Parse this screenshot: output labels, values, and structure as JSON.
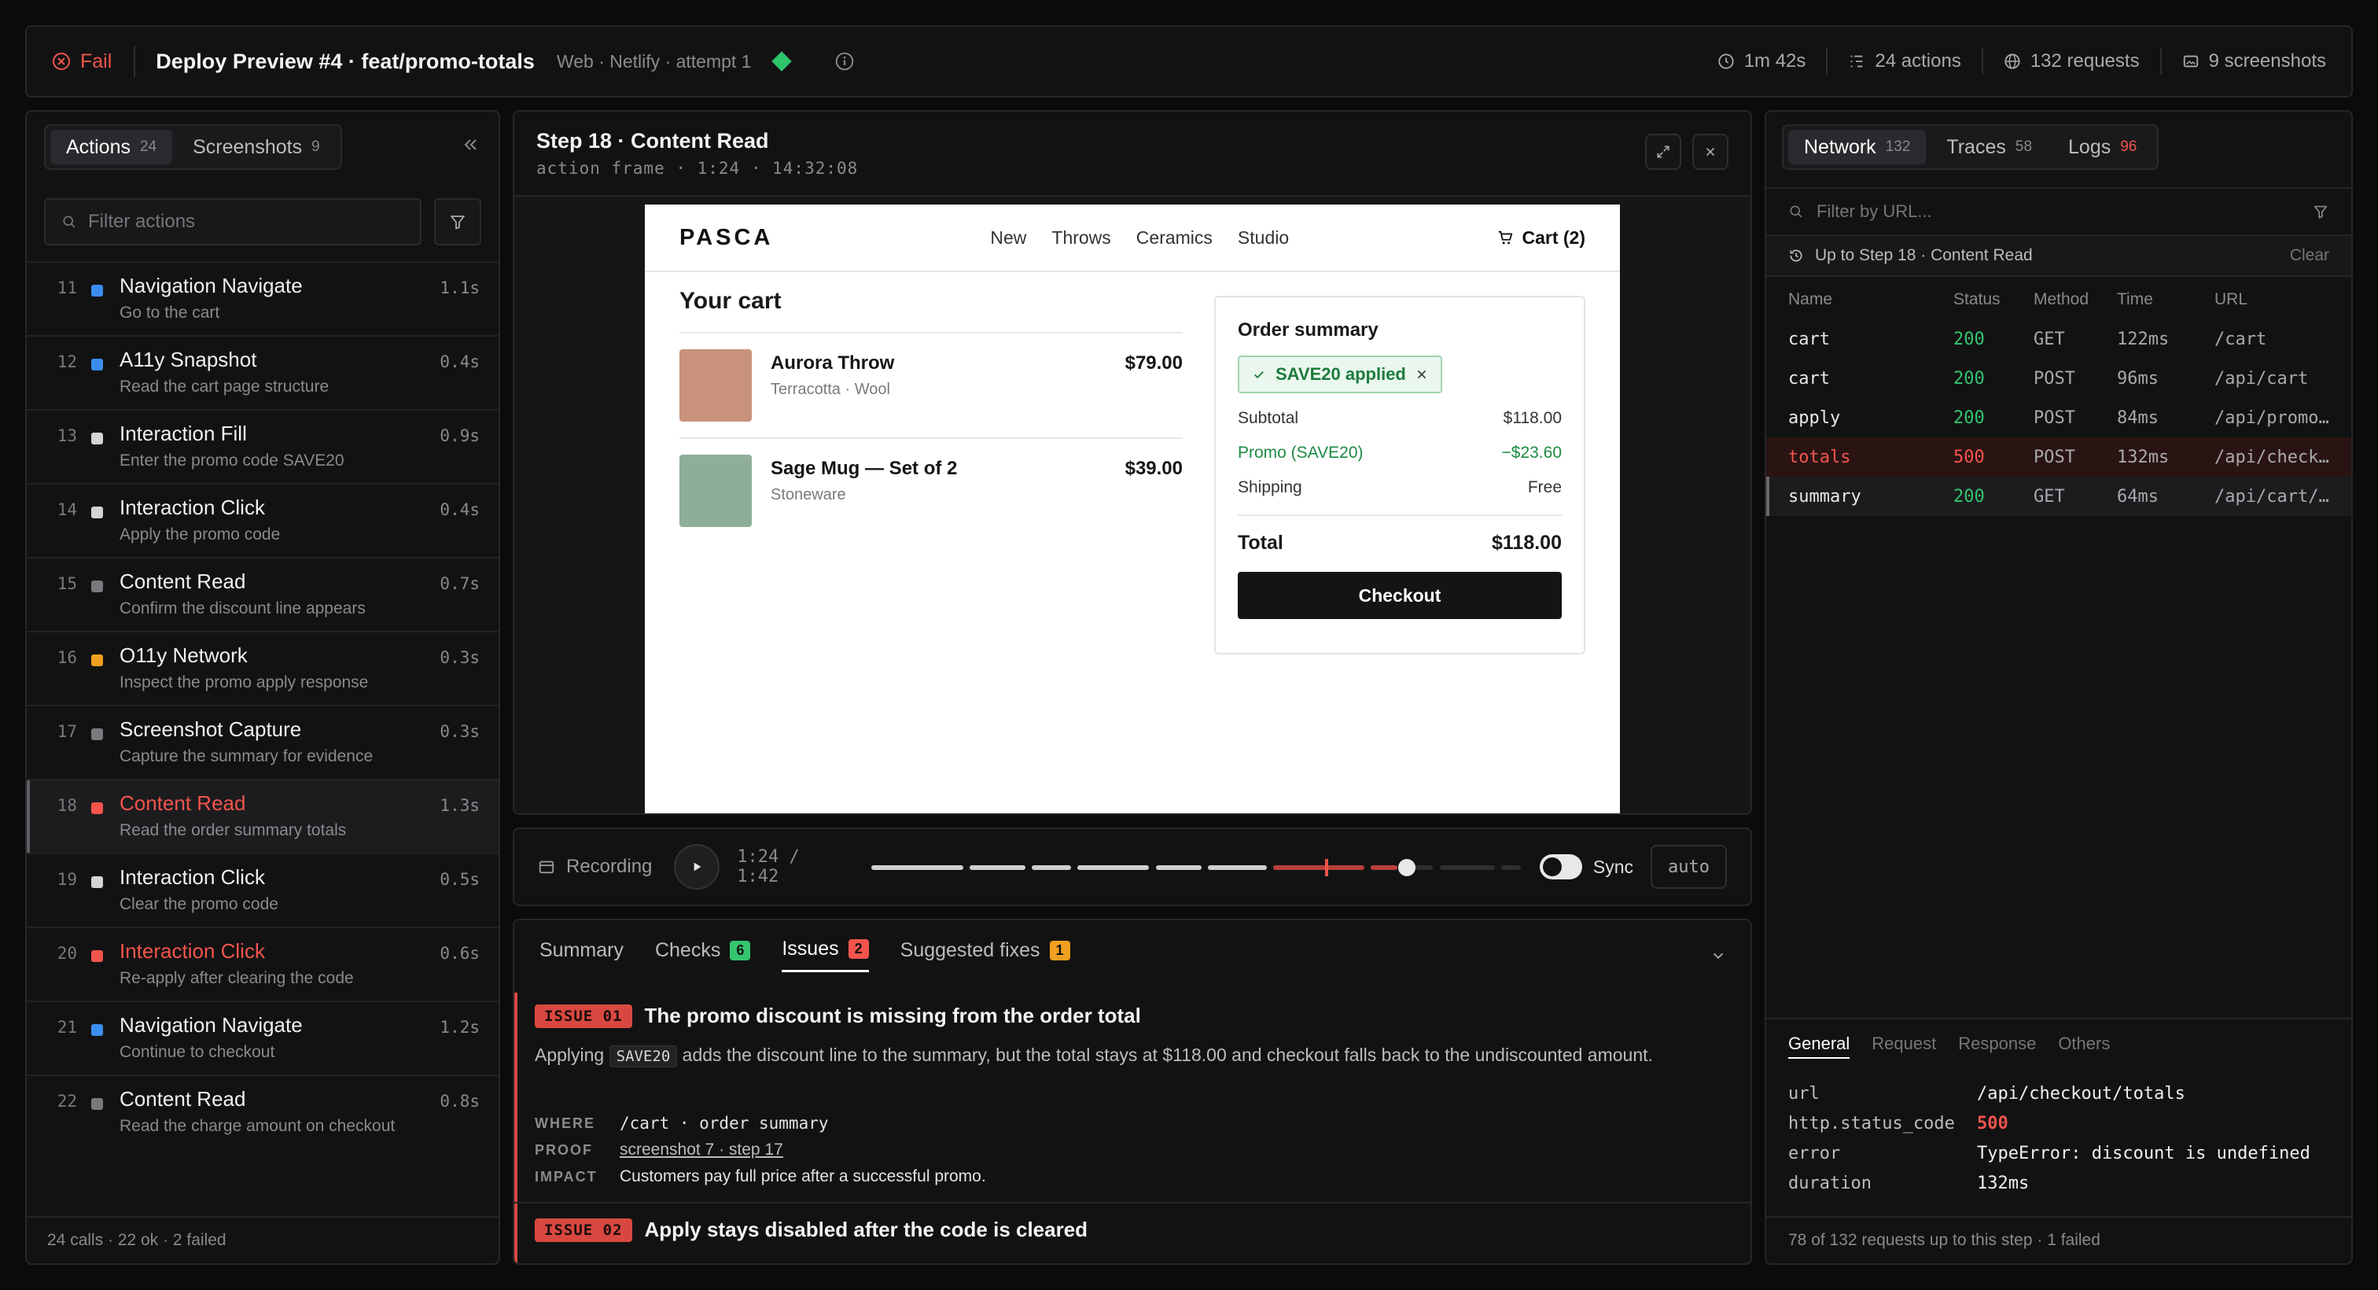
{
  "topbar": {
    "status": "Fail",
    "title": "Deploy Preview #4 · feat/promo-totals",
    "meta": "Web · Netlify · attempt 1",
    "duration": "1m 42s",
    "actions": "24 actions",
    "requests": "132 requests",
    "screenshots": "9 screenshots"
  },
  "left": {
    "tabs": [
      {
        "label": "Actions",
        "count": "24"
      },
      {
        "label": "Screenshots",
        "count": "9"
      }
    ],
    "filter_placeholder": "Filter actions",
    "actions": [
      {
        "num": "11",
        "title": "Navigation Navigate",
        "sub": "Go to the cart",
        "time": "1.1s",
        "color": "#3b8ef0",
        "failed": false
      },
      {
        "num": "12",
        "title": "A11y Snapshot",
        "sub": "Read the cart page structure",
        "time": "0.4s",
        "color": "#3b8ef0",
        "failed": false
      },
      {
        "num": "13",
        "title": "Interaction Fill",
        "sub": "Enter the promo code SAVE20",
        "time": "0.9s",
        "color": "#d4d4d6",
        "failed": false
      },
      {
        "num": "14",
        "title": "Interaction Click",
        "sub": "Apply the promo code",
        "time": "0.4s",
        "color": "#d4d4d6",
        "failed": false
      },
      {
        "num": "15",
        "title": "Content Read",
        "sub": "Confirm the discount line appears",
        "time": "0.7s",
        "color": "#7a7a7e",
        "failed": false
      },
      {
        "num": "16",
        "title": "O11y Network",
        "sub": "Inspect the promo apply response",
        "time": "0.3s",
        "color": "#f0a020",
        "failed": false
      },
      {
        "num": "17",
        "title": "Screenshot Capture",
        "sub": "Capture the summary for evidence",
        "time": "0.3s",
        "color": "#7a7a7e",
        "failed": false
      },
      {
        "num": "18",
        "title": "Content Read",
        "sub": "Read the order summary totals",
        "time": "1.3s",
        "color": "#f2554c",
        "failed": true
      },
      {
        "num": "19",
        "title": "Interaction Click",
        "sub": "Clear the promo code",
        "time": "0.5s",
        "color": "#d4d4d6",
        "failed": false
      },
      {
        "num": "20",
        "title": "Interaction Click",
        "sub": "Re-apply after clearing the code",
        "time": "0.6s",
        "color": "#f2554c",
        "failed": true
      },
      {
        "num": "21",
        "title": "Navigation Navigate",
        "sub": "Continue to checkout",
        "time": "1.2s",
        "color": "#3b8ef0",
        "failed": false
      },
      {
        "num": "22",
        "title": "Content Read",
        "sub": "Read the charge amount on checkout",
        "time": "0.8s",
        "color": "#7a7a7e",
        "failed": false
      }
    ],
    "footer": "24 calls · 22 ok · 2 failed"
  },
  "step": {
    "title": "Step 18 · Content Read",
    "sub": "action frame · 1:24 · 14:32:08"
  },
  "shop": {
    "brand": "PASCA",
    "links": [
      "New",
      "Throws",
      "Ceramics",
      "Studio"
    ],
    "cart_link": "Cart (2)",
    "cart_heading": "Your cart",
    "items": [
      {
        "name": "Aurora Throw",
        "sub": "Terracotta · Wool",
        "price": "$79.00",
        "color": "#c9927c"
      },
      {
        "name": "Sage Mug — Set of 2",
        "sub": "Stoneware",
        "price": "$39.00",
        "color": "#8fae98"
      }
    ],
    "summary": {
      "title": "Order summary",
      "promo_badge": "SAVE20 applied",
      "rows": [
        {
          "label": "Subtotal",
          "value": "$118.00"
        },
        {
          "label": "Promo (SAVE20)",
          "value": "−$23.60"
        },
        {
          "label": "Shipping",
          "value": "Free"
        }
      ],
      "total_label": "Total",
      "total_value": "$118.00",
      "checkout": "Checkout"
    }
  },
  "recording": {
    "label": "Recording",
    "time": "1:24 / 1:42",
    "progress": 0.82,
    "sync_label": "Sync",
    "auto": "auto"
  },
  "issues": {
    "tabs": [
      {
        "label": "Summary"
      },
      {
        "label": "Checks",
        "count": "6",
        "color": "#34c46e"
      },
      {
        "label": "Issues",
        "count": "2",
        "color": "#f2554c"
      },
      {
        "label": "Suggested fixes",
        "count": "1",
        "color": "#f0a020"
      }
    ],
    "list": [
      {
        "tag": "ISSUE 01",
        "title": "The promo discount is missing from the order total",
        "body_pre": "Applying",
        "body_code": "SAVE20",
        "body_post": "adds the discount line to the summary, but the total stays at $118.00 and checkout falls back to the undiscounted amount.",
        "where_label": "WHERE",
        "where": "/cart · order summary",
        "proof_label": "PROOF",
        "proof": "screenshot 7 · step 17",
        "impact_label": "IMPACT",
        "impact": "Customers pay full price after a successful promo."
      },
      {
        "tag": "ISSUE 02",
        "title": "Apply stays disabled after the code is cleared"
      }
    ]
  },
  "network": {
    "tabs": [
      {
        "label": "Network",
        "count": "132"
      },
      {
        "label": "Traces",
        "count": "58"
      },
      {
        "label": "Logs",
        "count": "96"
      }
    ],
    "filter_placeholder": "Filter by URL...",
    "step_label": "Up to Step 18 · Content Read",
    "clear": "Clear",
    "columns": [
      "Name",
      "Status",
      "Method",
      "Time",
      "URL"
    ],
    "rows": [
      {
        "name": "cart",
        "status": "200",
        "method": "GET",
        "time": "122ms",
        "url": "/cart"
      },
      {
        "name": "cart",
        "status": "200",
        "method": "POST",
        "time": "96ms",
        "url": "/api/cart"
      },
      {
        "name": "apply",
        "status": "200",
        "method": "POST",
        "time": "84ms",
        "url": "/api/promo…"
      },
      {
        "name": "totals",
        "status": "500",
        "method": "POST",
        "time": "132ms",
        "url": "/api/check…"
      },
      {
        "name": "summary",
        "status": "200",
        "method": "GET",
        "time": "64ms",
        "url": "/api/cart/…"
      }
    ],
    "detail_tabs": [
      "General",
      "Request",
      "Response",
      "Others"
    ],
    "detail": [
      {
        "key": "url",
        "value": "/api/checkout/totals"
      },
      {
        "key": "http.status_code",
        "value": "500"
      },
      {
        "key": "error",
        "value": "TypeError: discount is undefined"
      },
      {
        "key": "duration",
        "value": "132ms"
      }
    ],
    "footer": "78 of 132 requests up to this step · 1 failed"
  }
}
